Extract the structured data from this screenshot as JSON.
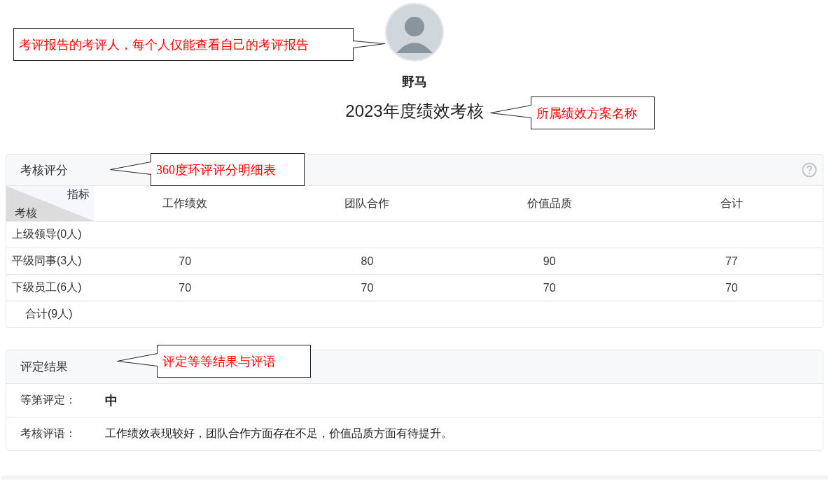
{
  "user": {
    "name": "野马"
  },
  "plan_title": "2023年度绩效考核",
  "score_panel": {
    "title": "考核评分",
    "corner_top": "指标",
    "corner_bottom": "考核",
    "columns": [
      "工作绩效",
      "团队合作",
      "价值品质",
      "合计"
    ],
    "rows": [
      {
        "label": "上级领导(0人)",
        "kind": "group"
      },
      {
        "label": "平级同事(3人)",
        "kind": "group",
        "cells": [
          "70",
          "80",
          "90",
          "77"
        ]
      },
      {
        "label": "下级员工(6人)",
        "kind": "group",
        "cells": [
          "70",
          "70",
          "70",
          "70"
        ]
      },
      {
        "label": "合计(9人)",
        "kind": "total"
      }
    ]
  },
  "result_panel": {
    "title": "评定结果",
    "fields": [
      {
        "label": "等第评定：",
        "value": "中",
        "kind": "grade"
      },
      {
        "label": "考核评语：",
        "value": "工作绩效表现较好，团队合作方面存在不足，价值品质方面有待提升。",
        "kind": "comment"
      }
    ]
  },
  "callouts": [
    {
      "text": "考评报告的考评人，每个人仅能查看自己的考评报告"
    },
    {
      "text": "所属绩效方案名称"
    },
    {
      "text": "360度环评评分明细表"
    },
    {
      "text": "评定等等结果与评语"
    }
  ]
}
